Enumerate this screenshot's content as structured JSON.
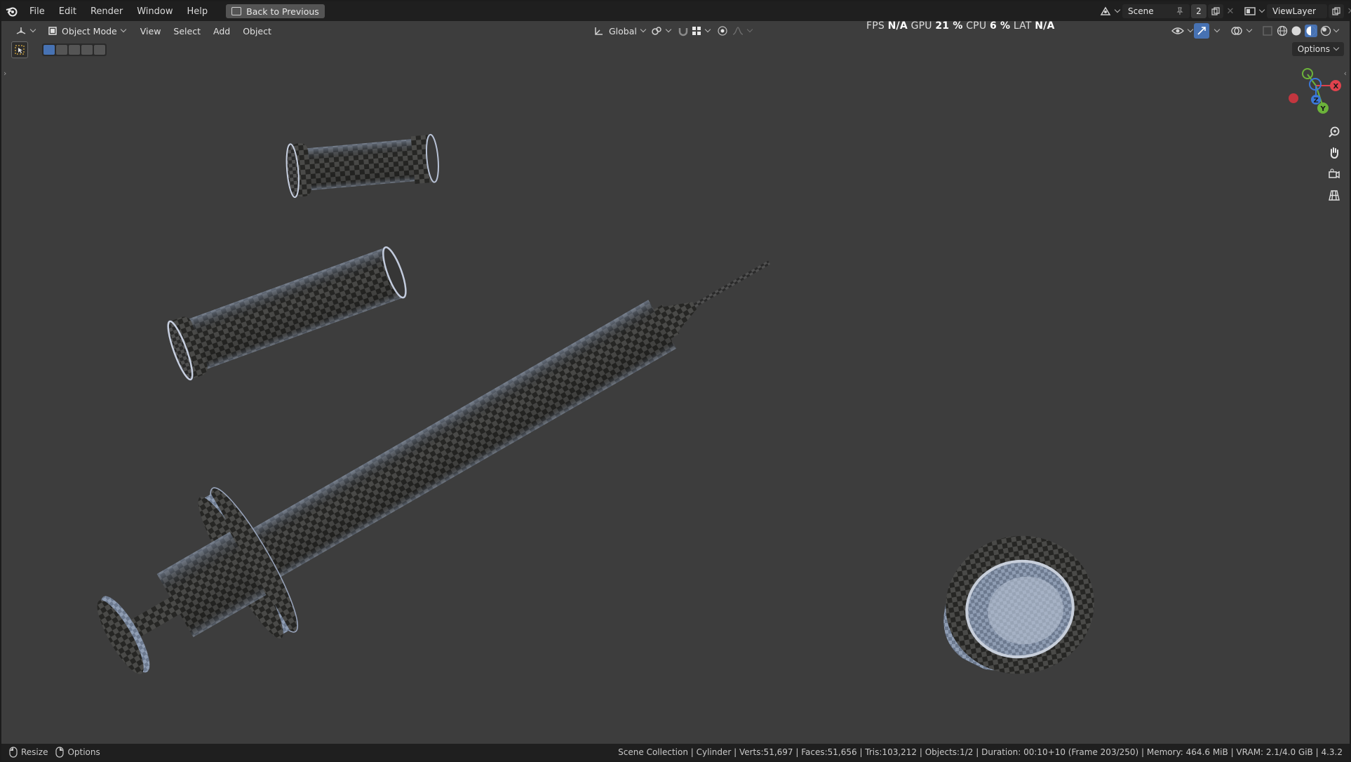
{
  "topbar": {
    "menus": [
      "File",
      "Edit",
      "Render",
      "Window",
      "Help"
    ],
    "back_button": "Back to Previous",
    "scene_name": "Scene",
    "scene_users": "2",
    "view_layer": "ViewLayer"
  },
  "viewport_header": {
    "mode": "Object Mode",
    "menus": [
      "View",
      "Select",
      "Add",
      "Object"
    ],
    "orientation": "Global",
    "options": "Options"
  },
  "stats": {
    "fps_label": "FPS",
    "fps_value": "N/A",
    "gpu_label": "GPU",
    "gpu_value": "21 %",
    "cpu_label": "CPU",
    "cpu_value": "6 %",
    "lat_label": "LAT",
    "lat_value": "N/A"
  },
  "gizmo": {
    "x": "X",
    "y": "Y",
    "z": "Z",
    "x_color": "#e0424d",
    "y_color": "#6cb33a",
    "z_color": "#3b78d8"
  },
  "statusbar": {
    "left_1": "Resize",
    "left_2": "Options",
    "right": "Scene Collection | Cylinder | Verts:51,697 | Faces:51,656 | Tris:103,212 | Objects:1/2 | Duration: 00:10+10 (Frame 203/250) | Memory: 464.6 MiB | VRAM: 2.1/4.0 GiB | 4.3.2"
  },
  "colors": {
    "viewport_bg": "#3d3d3d",
    "header_bg": "#1f1f1f",
    "accent": "#4772b3"
  }
}
